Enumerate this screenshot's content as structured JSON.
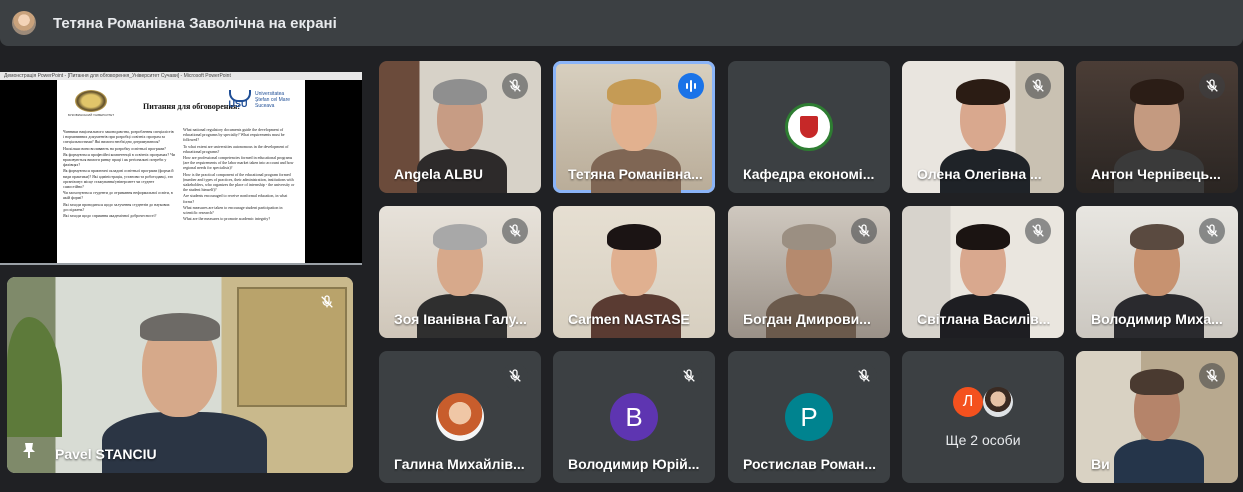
{
  "presentation_banner": {
    "title": "Тетяна Романівна Заволічна на екрані"
  },
  "shared_screen": {
    "window_title": "Демонстрація PowerPoint - [Питання для обговорення_Університет Сучави] - Microsoft PowerPoint",
    "slide": {
      "title": "Питання для обговорення:",
      "logo_left_caption": "БУКОВИНСЬКИЙ УНІВЕРСИТЕТ",
      "logo_right_abbr": "USU",
      "logo_right_name": "Universitatea Ştefan cel Mare Suceava",
      "left_column": [
        "Чинники національного законодавства, розроблення спеціалістів і нормативних документів при розробці освітніх програм за спеціальностями? Які вимоги необхідно дотримуватися?",
        "Наскільки вони впливають на розробку освітньої програми?",
        "Як формуються професійні компетенції в освітніх програмах? Чи враховуються вимоги ринку праці і як регіональні потреби у фахівцях?",
        "Як формуються практичні складові освітньої програми (форма й види практики)? Які адміністрація, установи та роботодавці, хто організовує місце стажування/університет чи студент самостійно?",
        "Чи заохочуються студенти до отримання неформальної освіти, в якій формі?",
        "Які заходи проводяться щодо залучення студентів до наукових досліджень?",
        "Які заходи щодо сприяння академічної доброчесності?"
      ],
      "right_column": [
        "What national regulatory documents guide the development of educational programs by specialty? What requirements must be followed?",
        "To what extent are universities autonomous in the development of educational programs?",
        "How are professional competencies formed in educational programs (are the requirements of the labor market taken into account and how regional needs for specialists)?",
        "How is the practical component of the educational program formed (number and types of practices, their administration, institutions with stakeholders, who organizes the place of internship - the university or the student himself)?",
        "Are students encouraged to receive nonformal education, in what forms?",
        "What measures are taken to encourage student participation in scientific research?",
        "What are the measures to promote academic integrity?"
      ]
    }
  },
  "presenter_tile": {
    "name": "Pavel STANCIU",
    "pin_icon": "pin-icon"
  },
  "participants": [
    {
      "name": "Angela ALBU",
      "state": "muted"
    },
    {
      "name": "Тетяна Романівна...",
      "state": "speaking"
    },
    {
      "name": "Кафедра економі...",
      "state": "no-mic-indicator"
    },
    {
      "name": "Олена Олегівна ...",
      "state": "muted"
    },
    {
      "name": "Антон Чернівець...",
      "state": "muted"
    },
    {
      "name": "Зоя Іванівна Галу...",
      "state": "muted"
    },
    {
      "name": "Carmen NASTASE",
      "state": "no-mic-indicator"
    },
    {
      "name": "Богдан Дмирови...",
      "state": "muted"
    },
    {
      "name": "Світлана Василів...",
      "state": "muted"
    },
    {
      "name": "Володимир Миха...",
      "state": "muted"
    },
    {
      "name": "Галина Михайлів...",
      "state": "muted"
    },
    {
      "name": "Володимир Юрій...",
      "state": "muted",
      "avatar_letter": "В",
      "avatar_color": "#5e35b1"
    },
    {
      "name": "Ростислав Роман...",
      "state": "muted",
      "avatar_letter": "Р",
      "avatar_color": "#00838f"
    },
    {
      "name": "Ще 2 особи",
      "state": "overflow",
      "avatar_letter": "Л",
      "avatar_color": "#f4511e"
    },
    {
      "name": "Ви",
      "state": "muted"
    }
  ],
  "colors": {
    "background": "#202124",
    "tile": "#3c4043",
    "active_outline": "#8ab4f8",
    "speaking": "#1a73e8"
  }
}
